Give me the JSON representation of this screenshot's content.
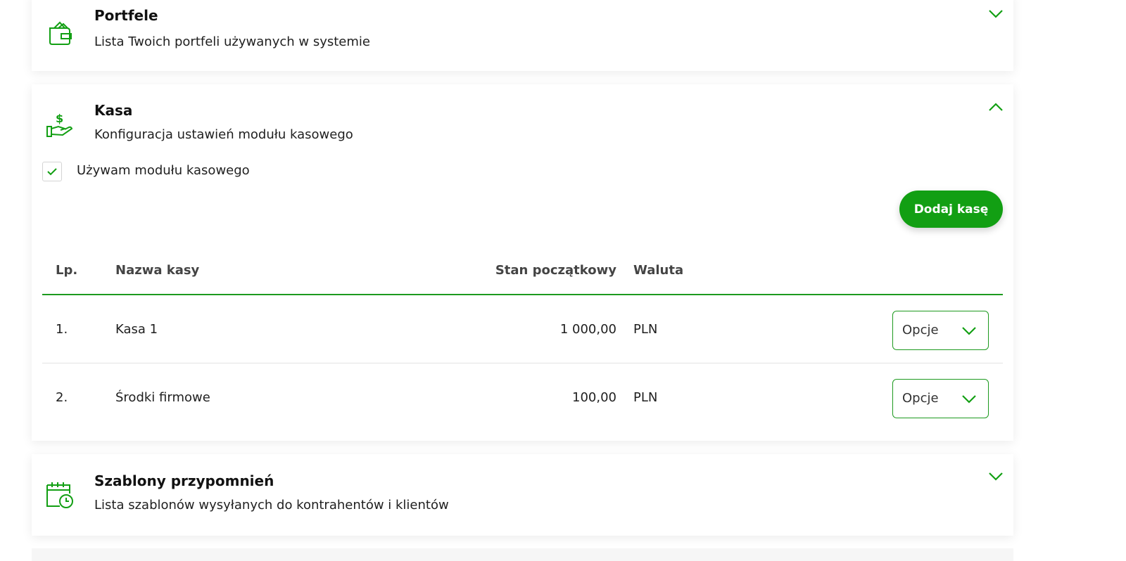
{
  "colors": {
    "accent": "#129f13",
    "border_accent": "#1d9a1f"
  },
  "portfele": {
    "icon": "wallet-icon",
    "title": "Portfele",
    "description": "Lista Twoich portfeli używanych w systemie",
    "state": "collapsed"
  },
  "kasa": {
    "icon": "cash-hand-icon",
    "title": "Kasa",
    "description": "Konfiguracja ustawień modułu kasowego",
    "state": "expanded",
    "checkbox": {
      "label": "Używam modułu kasowego",
      "checked": true
    },
    "add_button": "Dodaj kasę",
    "table": {
      "headers": {
        "lp": "Lp.",
        "name": "Nazwa kasy",
        "start": "Stan początkowy",
        "currency": "Waluta"
      },
      "rows": [
        {
          "lp": "1.",
          "name": "Kasa 1",
          "start": "1 000,00",
          "currency": "PLN",
          "options": "Opcje"
        },
        {
          "lp": "2.",
          "name": "Środki firmowe",
          "start": "100,00",
          "currency": "PLN",
          "options": "Opcje"
        }
      ]
    }
  },
  "szablony": {
    "icon": "calendar-clock-icon",
    "title": "Szablony przypomnień",
    "description": "Lista szablonów wysyłanych do kontrahentów i klientów",
    "state": "collapsed"
  }
}
